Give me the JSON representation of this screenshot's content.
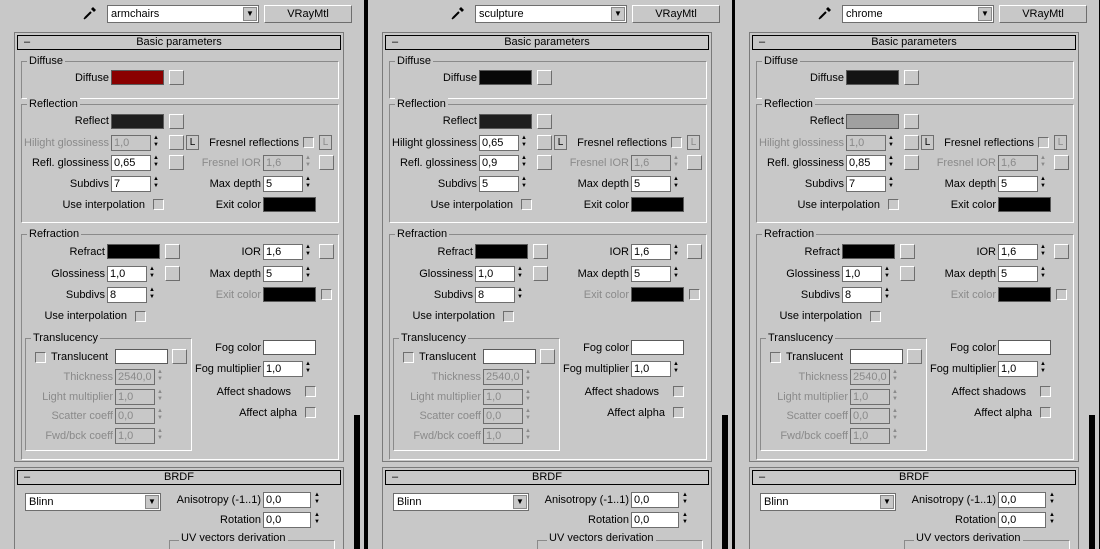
{
  "panels": [
    {
      "material_name": "armchairs",
      "type_button": "VRayMtl",
      "basic": {
        "header": "Basic parameters",
        "diffuse_group": "Diffuse",
        "diffuse_label": "Diffuse",
        "diffuse_color": "#8a0000",
        "reflection_group": "Reflection",
        "reflect_label": "Reflect",
        "reflect_color": "#1e1e1e",
        "hilight_label": "Hilight glossiness",
        "hilight_value": "1,0",
        "hilight_enabled": false,
        "l_button": "L",
        "fresnel_label": "Fresnel reflections",
        "refl_gloss_label": "Refl. glossiness",
        "refl_gloss_value": "0,65",
        "fresnel_ior_label": "Fresnel IOR",
        "fresnel_ior_value": "1,6",
        "subdivs_label": "Subdivs",
        "refl_subdivs_value": "7",
        "max_depth_label": "Max depth",
        "refl_max_depth_value": "5",
        "use_interp_label": "Use interpolation",
        "exit_color_label": "Exit color",
        "refraction_group": "Refraction",
        "refract_label": "Refract",
        "ior_label": "IOR",
        "ior_value": "1,6",
        "glossiness_label": "Glossiness",
        "refr_gloss_value": "1,0",
        "refr_max_depth_value": "5",
        "refr_subdivs_value": "8",
        "translucency_group": "Translucency",
        "translucent_label": "Translucent",
        "thickness_label": "Thickness",
        "thickness_value": "2540,0",
        "light_mult_label": "Light multiplier",
        "light_mult_value": "1,0",
        "scatter_label": "Scatter coeff",
        "scatter_value": "0,0",
        "fwd_label": "Fwd/bck coeff",
        "fwd_value": "1,0",
        "fog_color_label": "Fog color",
        "fog_mult_label": "Fog multiplier",
        "fog_mult_value": "1,0",
        "affect_shadows_label": "Affect shadows",
        "affect_alpha_label": "Affect alpha"
      },
      "brdf": {
        "header": "BRDF",
        "type": "Blinn",
        "anisotropy_label": "Anisotropy (-1..1)",
        "anisotropy_value": "0,0",
        "rotation_label": "Rotation",
        "rotation_value": "0,0",
        "uv_label": "UV vectors derivation"
      }
    },
    {
      "material_name": "sculpture",
      "type_button": "VRayMtl",
      "basic": {
        "header": "Basic parameters",
        "diffuse_group": "Diffuse",
        "diffuse_label": "Diffuse",
        "diffuse_color": "#080808",
        "reflection_group": "Reflection",
        "reflect_label": "Reflect",
        "reflect_color": "#1e1e1e",
        "hilight_label": "Hilight glossiness",
        "hilight_value": "0,65",
        "hilight_enabled": true,
        "l_button": "L",
        "fresnel_label": "Fresnel reflections",
        "refl_gloss_label": "Refl. glossiness",
        "refl_gloss_value": "0,9",
        "fresnel_ior_label": "Fresnel IOR",
        "fresnel_ior_value": "1,6",
        "subdivs_label": "Subdivs",
        "refl_subdivs_value": "5",
        "max_depth_label": "Max depth",
        "refl_max_depth_value": "5",
        "use_interp_label": "Use interpolation",
        "exit_color_label": "Exit color",
        "refraction_group": "Refraction",
        "refract_label": "Refract",
        "ior_label": "IOR",
        "ior_value": "1,6",
        "glossiness_label": "Glossiness",
        "refr_gloss_value": "1,0",
        "refr_max_depth_value": "5",
        "refr_subdivs_value": "8",
        "translucency_group": "Translucency",
        "translucent_label": "Translucent",
        "thickness_label": "Thickness",
        "thickness_value": "2540,0",
        "light_mult_label": "Light multiplier",
        "light_mult_value": "1,0",
        "scatter_label": "Scatter coeff",
        "scatter_value": "0,0",
        "fwd_label": "Fwd/bck coeff",
        "fwd_value": "1,0",
        "fog_color_label": "Fog color",
        "fog_mult_label": "Fog multiplier",
        "fog_mult_value": "1,0",
        "affect_shadows_label": "Affect shadows",
        "affect_alpha_label": "Affect alpha"
      },
      "brdf": {
        "header": "BRDF",
        "type": "Blinn",
        "anisotropy_label": "Anisotropy (-1..1)",
        "anisotropy_value": "0,0",
        "rotation_label": "Rotation",
        "rotation_value": "0,0",
        "uv_label": "UV vectors derivation"
      }
    },
    {
      "material_name": "chrome",
      "type_button": "VRayMtl",
      "basic": {
        "header": "Basic parameters",
        "diffuse_group": "Diffuse",
        "diffuse_label": "Diffuse",
        "diffuse_color": "#141414",
        "reflection_group": "Reflection",
        "reflect_label": "Reflect",
        "reflect_color": "#a0a0a0",
        "hilight_label": "Hilight glossiness",
        "hilight_value": "1,0",
        "hilight_enabled": false,
        "l_button": "L",
        "fresnel_label": "Fresnel reflections",
        "refl_gloss_label": "Refl. glossiness",
        "refl_gloss_value": "0,85",
        "fresnel_ior_label": "Fresnel IOR",
        "fresnel_ior_value": "1,6",
        "subdivs_label": "Subdivs",
        "refl_subdivs_value": "7",
        "max_depth_label": "Max depth",
        "refl_max_depth_value": "5",
        "use_interp_label": "Use interpolation",
        "exit_color_label": "Exit color",
        "refraction_group": "Refraction",
        "refract_label": "Refract",
        "ior_label": "IOR",
        "ior_value": "1,6",
        "glossiness_label": "Glossiness",
        "refr_gloss_value": "1,0",
        "refr_max_depth_value": "5",
        "refr_subdivs_value": "8",
        "translucency_group": "Translucency",
        "translucent_label": "Translucent",
        "thickness_label": "Thickness",
        "thickness_value": "2540,0",
        "light_mult_label": "Light multiplier",
        "light_mult_value": "1,0",
        "scatter_label": "Scatter coeff",
        "scatter_value": "0,0",
        "fwd_label": "Fwd/bck coeff",
        "fwd_value": "1,0",
        "fog_color_label": "Fog color",
        "fog_mult_label": "Fog multiplier",
        "fog_mult_value": "1,0",
        "affect_shadows_label": "Affect shadows",
        "affect_alpha_label": "Affect alpha"
      },
      "brdf": {
        "header": "BRDF",
        "type": "Blinn",
        "anisotropy_label": "Anisotropy (-1..1)",
        "anisotropy_value": "0,0",
        "rotation_label": "Rotation",
        "rotation_value": "0,0",
        "uv_label": "UV vectors derivation"
      }
    }
  ],
  "colors": {
    "ui_gray": "#c8c8c8",
    "exit_color": "#000000",
    "refract_color": "#000000",
    "fog_color": "#ffffff",
    "translucent_color": "#ffffff"
  },
  "icons": {
    "picker": "eyedropper-icon",
    "minus": "minus-icon",
    "spinner": "spinner-arrows-icon",
    "dropdown": "chevron-down-icon"
  },
  "symbols": {
    "minus": "–",
    "up": "▲",
    "down": "▼",
    "caret": "▼"
  }
}
